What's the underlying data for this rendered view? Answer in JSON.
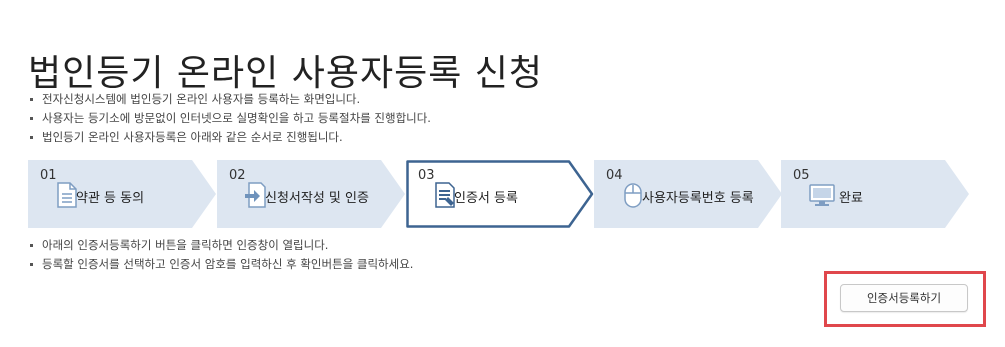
{
  "page": {
    "title": "법인등기 온라인 사용자등록 신청"
  },
  "intro_bullets": [
    "전자신청시스템에 법인등기 온라인 사용자를 등록하는 화면입니다.",
    "사용자는 등기소에 방문없이 인터넷으로 실명확인을 하고 등록절차를 진행합니다.",
    "법인등기 온라인 사용자등록은 아래와 같은 순서로 진행됩니다."
  ],
  "steps": [
    {
      "number": "01",
      "label": "약관 등 동의",
      "icon": "document-icon",
      "active": false
    },
    {
      "number": "02",
      "label": "신청서작성 및 인증",
      "icon": "form-arrow-icon",
      "active": false
    },
    {
      "number": "03",
      "label": "인증서 등록",
      "icon": "certificate-icon",
      "active": true
    },
    {
      "number": "04",
      "label": "사용자등록번호 등록",
      "icon": "mouse-icon",
      "active": false
    },
    {
      "number": "05",
      "label": "완료",
      "icon": "monitor-icon",
      "active": false
    }
  ],
  "guide_bullets": [
    "아래의 인증서등록하기 버튼을 클릭하면 인증창이 열립니다.",
    "등록할 인증서를 선택하고 인증서 암호를 입력하신 후 확인버튼을 클릭하세요."
  ],
  "actions": {
    "register_cert_label": "인증서등록하기"
  },
  "colors": {
    "step_fill": "#dde6f1",
    "active_border": "#3d6491",
    "icon_blue": "#6f93bc",
    "highlight_red": "#e0474c"
  }
}
